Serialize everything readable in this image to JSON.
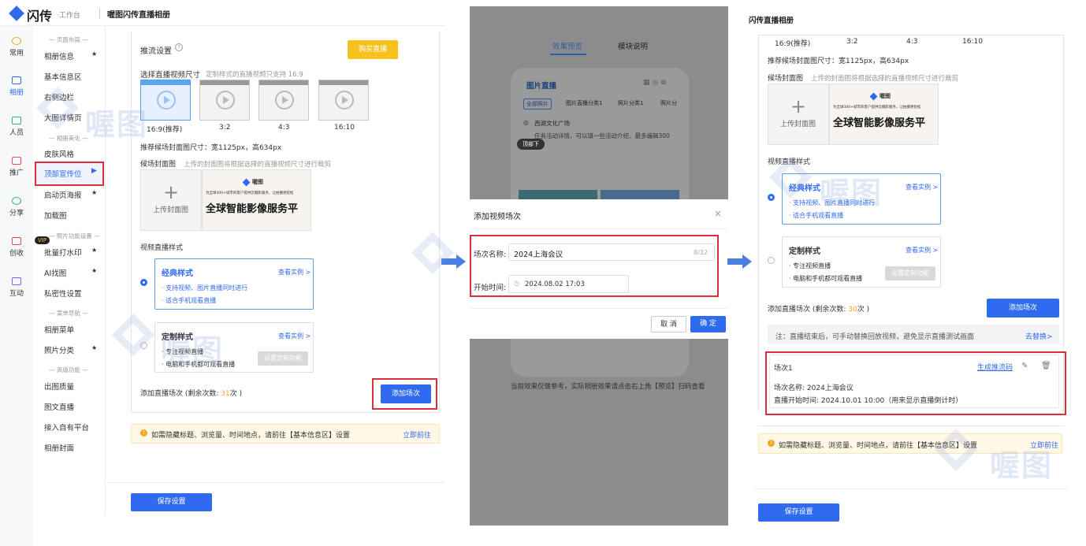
{
  "panel1": {
    "logo_text": "闪传",
    "logo_sub": "·工作台",
    "header_title": "喔图闪传直播相册",
    "sidebar": [
      {
        "label": "常用"
      },
      {
        "label": "相册"
      },
      {
        "label": "人员"
      },
      {
        "label": "推广"
      },
      {
        "label": "分享"
      },
      {
        "label": "创收"
      },
      {
        "label": "互动"
      }
    ],
    "nav_headers": [
      "— 页面布局 —",
      "— 相册美化 —",
      "— 照片功能设置 —",
      "— 菜单导航 —",
      "— 高级功能 —"
    ],
    "nav": {
      "album_info": "相册信息",
      "basic_info": "基本信息区",
      "right_bar": "右侧边栏",
      "big_detail": "大图详情页",
      "skin": "皮肤风格",
      "top_banner": "顶部宣传位",
      "start_poster": "启动页海报",
      "loading": "加载图",
      "watermark": "批量打水印",
      "ai_retouch": "AI找图",
      "privacy": "私密性设置",
      "album_menu": "相册菜单",
      "photo_category": "照片分类",
      "photo_quality": "出图质量",
      "graphic_live": "图文直播",
      "own_platform": "接入自有平台",
      "album_cover": "相册封面"
    },
    "vip_badge": "VIP",
    "stream_settings": "推流设置",
    "buy_live": "购买直播",
    "choose_size": "选择直播视频尺寸",
    "choose_size_note": "定制样式的直播视频只支持 16:9",
    "ratios": [
      "16:9(推荐)",
      "3:2",
      "4:3",
      "16:10"
    ],
    "cover_recommend": "推荐候场封面图尺寸：宽1125px，高634px",
    "cover_label": "候场封面图",
    "cover_note": "上传的封面图将根据选择的直播视频尺寸进行裁剪",
    "upload_cover": "上传封面图",
    "cover_brand": "喔图",
    "cover_tagline": "为全球300+城市的客户提供云摄影服务，让拍摄更轻松",
    "cover_slogan": "全球智能影像服务平",
    "video_style": "视频直播样式",
    "classic_title": "经典样式",
    "view_example": "查看实例 >",
    "classic_f1": "· 支持视频、图片直播同时进行",
    "classic_f2": "· 适合手机观看直播",
    "custom_title": "定制样式",
    "custom_f1": "· 专注视频直播",
    "custom_f2": "· 电脑和手机都可观看直播",
    "custom_btn": "设置定制功能",
    "add_sessions_prefix": "添加直播场次 (剩余次数: ",
    "remaining": "31",
    "add_sessions_suffix": "次 )",
    "add_session_btn": "添加场次",
    "notice": "如需隐藏标题、浏览量、时间地点，请前往【基本信息区】设置",
    "goto": "立即前往",
    "save": "保存设置",
    "watermark_text": "喔图"
  },
  "panel2": {
    "tab_preview": "效果预览",
    "tab_module": "模块说明",
    "phone_title": "图片直播",
    "chips": [
      "全部照片",
      "图片直播分类1",
      "照片分类1",
      "照片分"
    ],
    "location": "西湖文化广场",
    "desc": "任务活动详情，可以填一些活动介绍，最多编辑300",
    "pill": "顶部下",
    "dialog_title": "添加视频场次",
    "close": "×",
    "name_label": "场次名称:",
    "name_value": "2024上海会议",
    "name_count": "8/32",
    "time_label": "开始时间:",
    "time_value": "2024.08.02 17:03",
    "cancel": "取 消",
    "confirm": "确 定",
    "bottom_note": "当前效果仅做参考，实际相册效果请点击右上角【预览】扫码查看"
  },
  "panel3": {
    "title": "闪传直播相册",
    "ratios": [
      "16:9(推荐)",
      "3:2",
      "4:3",
      "16:10"
    ],
    "cover_recommend": "推荐候场封面图尺寸：宽1125px，高634px",
    "cover_label": "候场封面图",
    "cover_note": "上传的封面图将根据选择的直播视频尺寸进行裁剪",
    "upload_cover": "上传封面图",
    "cover_brand": "喔图",
    "cover_tagline": "为全球300+城市的客户提供云摄影服务，让拍摄更轻松",
    "cover_slogan": "全球智能影像服务平",
    "video_style": "视频直播样式",
    "classic_title": "经典样式",
    "view_example": "查看实例 >",
    "classic_f1": "· 支持视频、图片直播同时进行",
    "classic_f2": "· 适合手机观看直播",
    "custom_title": "定制样式",
    "custom_f1": "· 专注视频直播",
    "custom_f2": "· 电脑和手机都可观看直播",
    "custom_btn": "设置定制功能",
    "add_sessions_prefix": "添加直播场次 (剩余次数: ",
    "remaining": "30",
    "add_sessions_suffix": "次 )",
    "add_session_btn": "添加场次",
    "replace_note": "注：直播结束后，可手动替换回放视频，避免显示直播测试画面",
    "replace_link": "去替换>",
    "session_label": "场次1",
    "gen_stream_code": "生成推流码",
    "session_name": "场次名称: 2024上海会议",
    "session_time": "直播开始时间: 2024.10.01 10:00（用来显示直播倒计时）",
    "notice": "如需隐藏标题、浏览量、时间地点，请前往【基本信息区】设置",
    "goto": "立即前往",
    "save": "保存设置",
    "watermark_text": "喔图"
  }
}
